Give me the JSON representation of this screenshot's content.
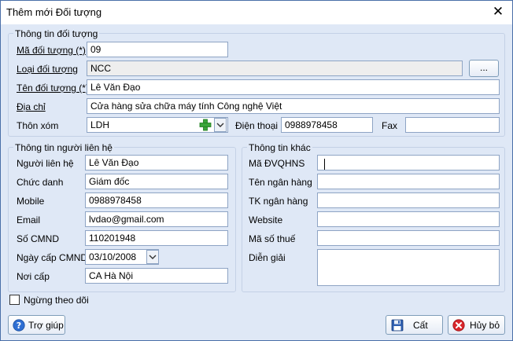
{
  "window": {
    "title": "Thêm mới Đối tượng"
  },
  "main_group": {
    "title": "Thông tin đối tượng",
    "ma_label": "Mã đối tượng (*)",
    "ma_value": "09",
    "loai_label": "Loại đối tượng",
    "loai_value": "NCC",
    "browse_label": "...",
    "ten_label": "Tên đối tượng (*)",
    "ten_value": "Lê Văn Đạo",
    "diachi_label": "Địa chỉ",
    "diachi_value": "Cửa hàng sửa chữa máy tính Công nghệ Việt",
    "thonxom_label": "Thôn xóm",
    "thonxom_value": "LDH",
    "dienthoai_label": "Điện thoại",
    "dienthoai_value": "0988978458",
    "fax_label": "Fax",
    "fax_value": ""
  },
  "contact_group": {
    "title": "Thông tin người liên hệ",
    "nguoi_label": "Người liên hệ",
    "nguoi_value": "Lê Văn Đạo",
    "chucdanh_label": "Chức danh",
    "chucdanh_value": "Giám đốc",
    "mobile_label": "Mobile",
    "mobile_value": "0988978458",
    "email_label": "Email",
    "email_value": "lvdao@gmail.com",
    "cmnd_label": "Số CMND",
    "cmnd_value": "110201948",
    "ngaycap_label": "Ngày cấp CMND",
    "ngaycap_value": "03/10/2008",
    "noicap_label": "Nơi cấp",
    "noicap_value": "CA Hà Nội"
  },
  "other_group": {
    "title": "Thông tin khác",
    "madvqhns_label": "Mã ĐVQHNS",
    "madvqhns_value": "",
    "tennganhang_label": "Tên ngân hàng",
    "tennganhang_value": "",
    "tknganhang_label": "TK ngân hàng",
    "tknganhang_value": "",
    "website_label": "Website",
    "website_value": "",
    "masothue_label": "Mã số thuế",
    "masothue_value": "",
    "diengiai_label": "Diễn giải",
    "diengiai_value": ""
  },
  "footer": {
    "ngung_label": "Ngừng theo dõi",
    "help_label": "Trợ giúp",
    "save_label": "Cất",
    "cancel_label": "Hủy bỏ"
  }
}
